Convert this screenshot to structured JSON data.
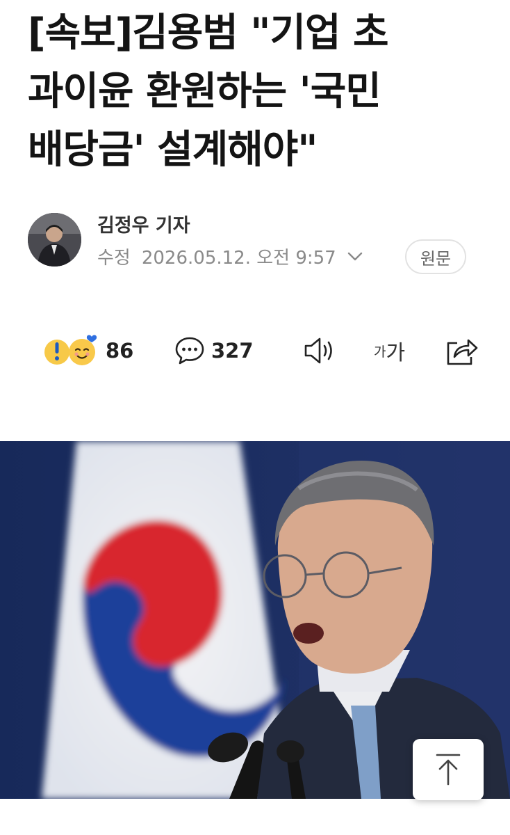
{
  "article": {
    "headline_lines": [
      "[속보]김용범 \"기업 초",
      "과이윤 환원하는 '국민",
      "배당금' 설계해야\""
    ],
    "author": "김정우 기자",
    "modified_label": "수정",
    "datetime": "2026.05.12. 오전 9:57",
    "original_button": "원문"
  },
  "actions": {
    "reaction_count": "86",
    "comment_count": "327",
    "font_size_small": "가",
    "font_size_large": "가"
  },
  "icons": {
    "reaction": "reaction-emoji-icon",
    "comment": "speech-bubble-icon",
    "listen": "speaker-icon",
    "share": "share-icon",
    "dropdown": "chevron-down-icon",
    "scroll_top": "arrow-up-icon"
  },
  "colors": {
    "text": "#141414",
    "muted": "#8a8a8a",
    "flag_red": "#d8262e",
    "flag_blue": "#1f3f9a"
  }
}
